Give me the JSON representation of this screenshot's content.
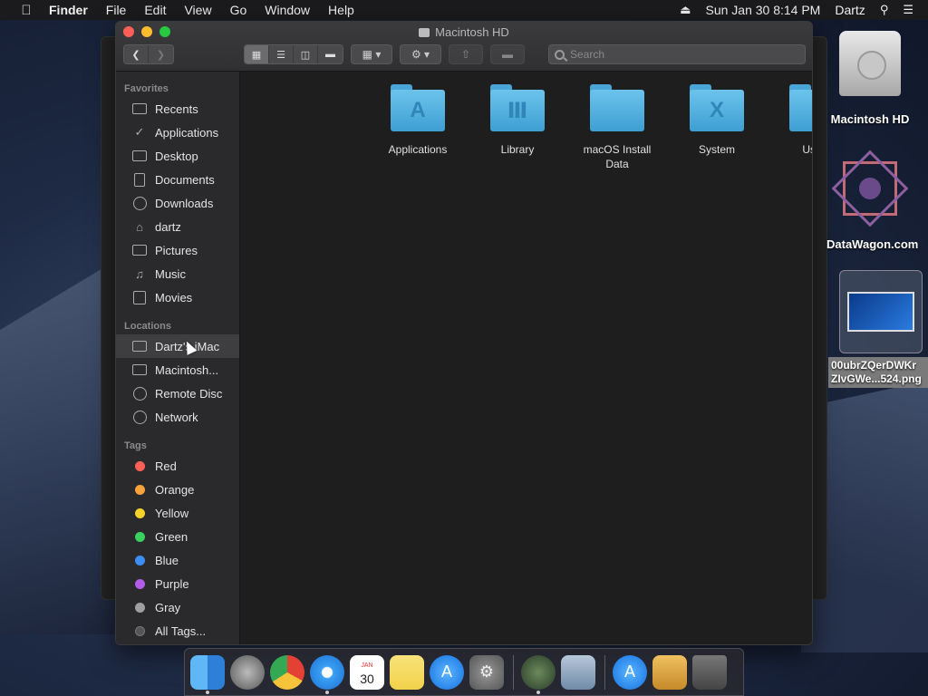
{
  "menubar": {
    "app": "Finder",
    "items": [
      "File",
      "Edit",
      "View",
      "Go",
      "Window",
      "Help"
    ],
    "datetime": "Sun Jan 30  8:14 PM",
    "user": "Dartz"
  },
  "window": {
    "title": "Macintosh HD",
    "search_placeholder": "Search"
  },
  "sidebar": {
    "favorites_header": "Favorites",
    "favorites": [
      "Recents",
      "Applications",
      "Desktop",
      "Documents",
      "Downloads",
      "dartz",
      "Pictures",
      "Music",
      "Movies"
    ],
    "locations_header": "Locations",
    "locations": [
      "Dartz's iMac",
      "Macintosh...",
      "Remote Disc",
      "Network"
    ],
    "tags_header": "Tags",
    "tags": [
      {
        "label": "Red",
        "color": "#fe5f57"
      },
      {
        "label": "Orange",
        "color": "#f7a23a"
      },
      {
        "label": "Yellow",
        "color": "#f5d329"
      },
      {
        "label": "Green",
        "color": "#3bd15e"
      },
      {
        "label": "Blue",
        "color": "#3c8ef5"
      },
      {
        "label": "Purple",
        "color": "#b25ce8"
      },
      {
        "label": "Gray",
        "color": "#a0a0a0"
      }
    ],
    "all_tags": "All Tags..."
  },
  "content": {
    "items": [
      {
        "label": "Applications",
        "glyph": "A"
      },
      {
        "label": "Library",
        "glyph": "Ⅲ"
      },
      {
        "label": "macOS Install Data",
        "glyph": ""
      },
      {
        "label": "System",
        "glyph": "X"
      },
      {
        "label": "Users",
        "glyph": "●"
      }
    ]
  },
  "desktop": {
    "hd_label": "Macintosh HD",
    "datawagon_label": "DataWagon.com",
    "png_label_line1": "00ubrZQerDWKr",
    "png_label_line2": "ZIvGWe...524.png"
  },
  "dock": {
    "calendar_month": "JAN",
    "calendar_day": "30"
  }
}
